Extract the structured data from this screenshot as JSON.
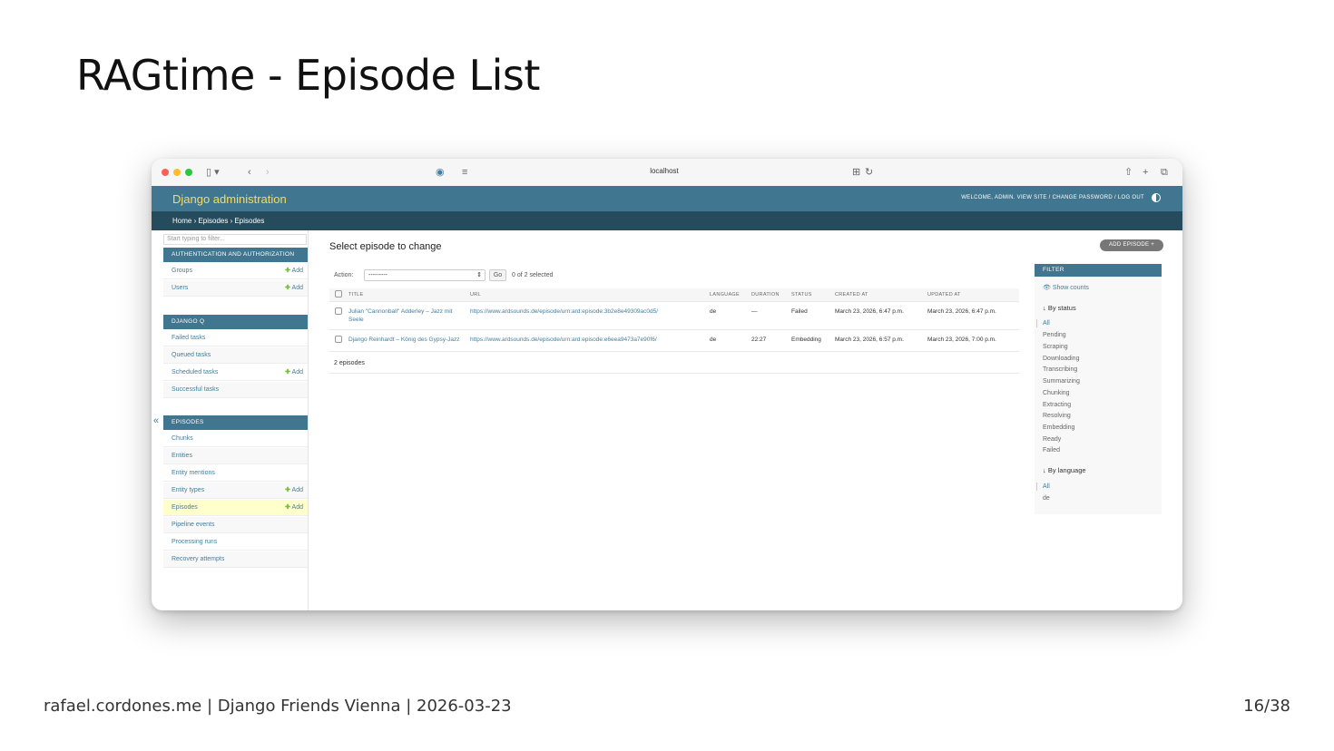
{
  "slide": {
    "title": "RAGtime - Episode List",
    "footer_left": "rafael.cordones.me | Django Friends Vienna | 2026-03-23",
    "page_number": "16/38"
  },
  "browser": {
    "url": "localhost"
  },
  "admin": {
    "brand": "Django administration",
    "user_tools": "WELCOME, ADMIN. VIEW SITE / CHANGE PASSWORD / LOG OUT",
    "breadcrumbs": "Home › Episodes › Episodes"
  },
  "sidebar": {
    "filter_placeholder": "Start typing to filter...",
    "collapse_glyph": "«",
    "add_label": "Add",
    "modules": [
      {
        "caption": "AUTHENTICATION AND AUTHORIZATION",
        "models": [
          {
            "label": "Groups",
            "add": true
          },
          {
            "label": "Users",
            "add": true
          }
        ]
      },
      {
        "caption": "DJANGO Q",
        "models": [
          {
            "label": "Failed tasks",
            "add": false
          },
          {
            "label": "Queued tasks",
            "add": false
          },
          {
            "label": "Scheduled tasks",
            "add": true
          },
          {
            "label": "Successful tasks",
            "add": false
          }
        ]
      },
      {
        "caption": "EPISODES",
        "models": [
          {
            "label": "Chunks",
            "add": false
          },
          {
            "label": "Entities",
            "add": false
          },
          {
            "label": "Entity mentions",
            "add": false
          },
          {
            "label": "Entity types",
            "add": true
          },
          {
            "label": "Episodes",
            "add": true,
            "selected": true
          },
          {
            "label": "Pipeline events",
            "add": false
          },
          {
            "label": "Processing runs",
            "add": false
          },
          {
            "label": "Recovery attempts",
            "add": false
          }
        ]
      }
    ]
  },
  "main": {
    "heading": "Select episode to change",
    "add_button": "ADD EPISODE +",
    "action_label": "Action:",
    "action_value": "---------",
    "go_label": "Go",
    "selected_count": "0 of 2 selected",
    "columns": [
      "TITLE",
      "URL",
      "LANGUAGE",
      "DURATION",
      "STATUS",
      "CREATED AT",
      "UPDATED AT"
    ],
    "rows": [
      {
        "title": "Julian \"Cannonball\" Adderley – Jazz mit Seele",
        "url": "https://www.ardsounds.de/episode/urn:ard:episode:3b2e8e49309ac0d5/",
        "language": "de",
        "duration": "—",
        "status": "Failed",
        "created_at": "March 23, 2026, 6:47 p.m.",
        "updated_at": "March 23, 2026, 6:47 p.m."
      },
      {
        "title": "Django Reinhardt – König des Gypsy-Jazz",
        "url": "https://www.ardsounds.de/episode/urn:ard:episode:e6eea9473a7e90f6/",
        "language": "de",
        "duration": "22:27",
        "status": "Embedding",
        "created_at": "March 23, 2026, 6:57 p.m.",
        "updated_at": "March 23, 2026, 7:00 p.m."
      }
    ],
    "paginator": "2 episodes"
  },
  "filter": {
    "header": "FILTER",
    "show_counts": "Show counts",
    "by_status": {
      "title": "By status",
      "options": [
        "All",
        "Pending",
        "Scraping",
        "Downloading",
        "Transcribing",
        "Summarizing",
        "Chunking",
        "Extracting",
        "Resolving",
        "Embedding",
        "Ready",
        "Failed"
      ],
      "selected": "All"
    },
    "by_language": {
      "title": "By language",
      "options": [
        "All",
        "de"
      ],
      "selected": "All"
    }
  },
  "colors": {
    "header_bg": "#417690",
    "breadcrumbs_bg": "#264b5d",
    "brand_text": "#f5dd5d",
    "link": "#447e9b",
    "add_icon": "#70bf2b",
    "selected_row": "#ffffcc"
  }
}
